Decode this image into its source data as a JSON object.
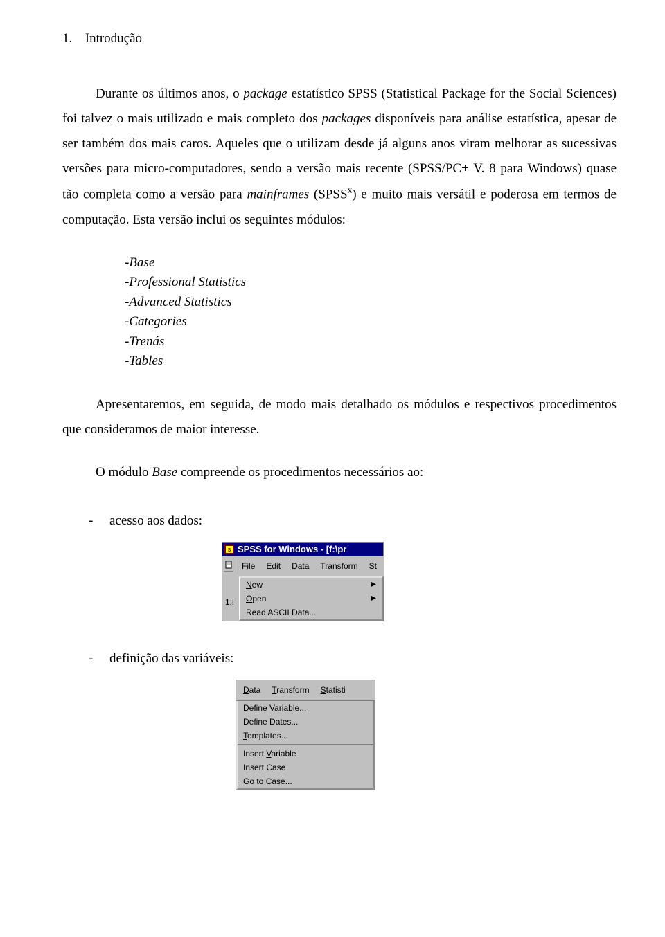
{
  "heading": {
    "number": "1.",
    "title": "Introdução"
  },
  "paragraphs": {
    "p1_a": "Durante os últimos anos, o ",
    "p1_b": "package",
    "p1_c": " estatístico SPSS (Statistical Package for the Social Sciences) foi talvez o mais utilizado e mais completo dos ",
    "p1_d": "packages",
    "p1_e": " disponíveis para análise estatística, apesar de ser também dos mais caros. Aqueles que o utilizam desde já alguns anos viram melhorar  as sucessivas versões para micro-computadores, sendo a versão mais recente (SPSS/PC+ V. 8 para Windows) quase tão completa como a versão para ",
    "p1_f": "mainframes",
    "p1_g_a": " (SPSS",
    "p1_g_sup": "x",
    "p1_g_b": ") e muito mais versátil e poderosa em termos de computação. Esta versão inclui os seguintes módulos:"
  },
  "modules": [
    "-Base",
    "-Professional Statistics",
    "-Advanced Statistics",
    "-Categories",
    "-Trenás",
    "-Tables"
  ],
  "para2": "Apresentaremos, em seguida, de modo mais detalhado os módulos e respectivos procedimentos que consideramos de maior interesse.",
  "para3_a": "O módulo ",
  "para3_b": "Base",
  "para3_c": " compreende os procedimentos necessários ao:",
  "items": {
    "access": "acesso aos dados:",
    "definition": "definição das variáveis:"
  },
  "dash": "-",
  "win1": {
    "title": "SPSS for Windows - [f:\\pr",
    "menu": [
      "File",
      "Edit",
      "Data",
      "Transform",
      "St"
    ],
    "menu_u": [
      "F",
      "E",
      "D",
      "T",
      "S"
    ],
    "menuitems": [
      {
        "label": "New",
        "u": "N",
        "sub": true
      },
      {
        "label": "Open",
        "u": "O",
        "sub": true
      },
      {
        "label": "Read ASCII Data...",
        "u": "",
        "sub": false
      }
    ],
    "onei": "1:i"
  },
  "win2": {
    "menu": [
      "Data",
      "Transform",
      "Statisti"
    ],
    "menu_u": [
      "D",
      "T",
      "S"
    ],
    "menuitems": [
      {
        "label": "Define Variable...",
        "u": ""
      },
      {
        "label": "Define Dates...",
        "u": ""
      },
      {
        "label": "Templates...",
        "u": "T"
      },
      {
        "label": "Insert Variable",
        "u": "V"
      },
      {
        "label": "Insert Case",
        "u": ""
      },
      {
        "label": "Go to Case...",
        "u": "G"
      }
    ]
  }
}
